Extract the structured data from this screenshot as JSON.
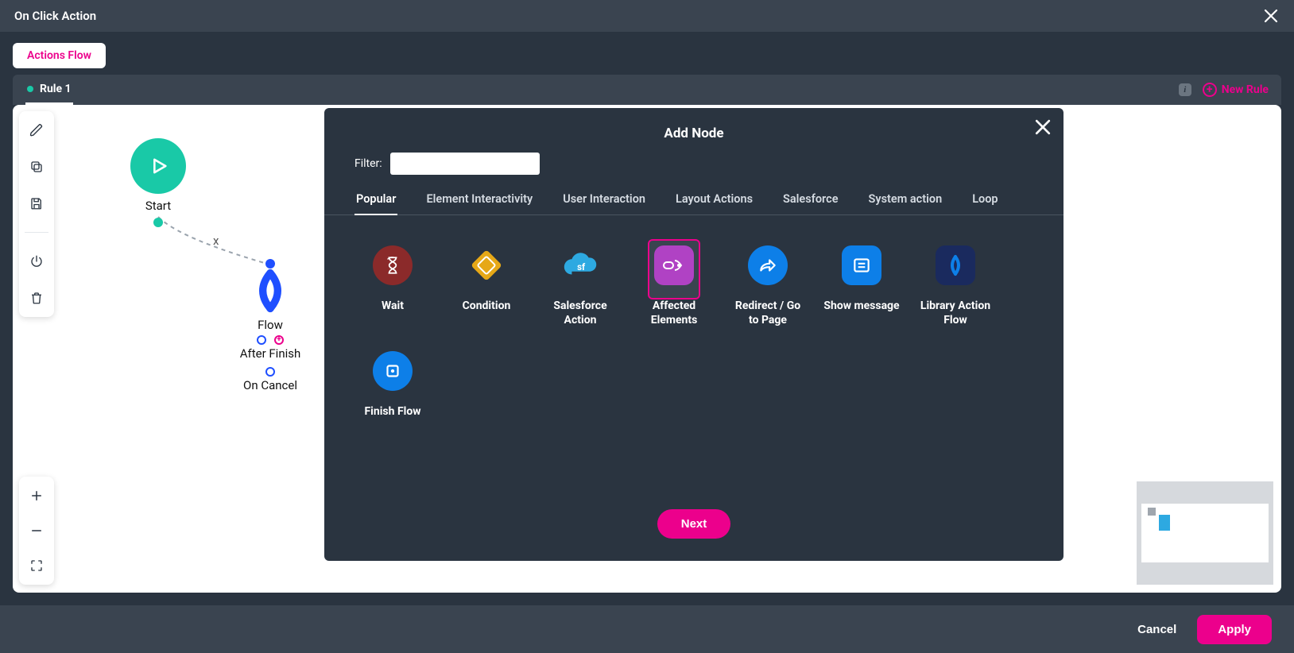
{
  "title": "On Click Action",
  "flow_tab_label": "Actions Flow",
  "rule_tab_label": "Rule 1",
  "new_rule_label": "New Rule",
  "canvas": {
    "start_label": "Start",
    "flow_label": "Flow",
    "after_finish_label": "After Finish",
    "on_cancel_label": "On Cancel",
    "edge_marker": "x"
  },
  "panel": {
    "title": "Add Node",
    "filter_label": "Filter:",
    "filter_value": "",
    "categories": [
      "Popular",
      "Element Interactivity",
      "User Interaction",
      "Layout Actions",
      "Salesforce",
      "System action",
      "Loop"
    ],
    "active_category": 0,
    "nodes": [
      {
        "name": "Wait",
        "color": "#8b2a2a",
        "selected": false
      },
      {
        "name": "Condition",
        "color": "#e6a817",
        "selected": false
      },
      {
        "name": "Salesforce Action",
        "color": "#2da9e1",
        "selected": false
      },
      {
        "name": "Affected Elements",
        "color": "#b042c4",
        "selected": true
      },
      {
        "name": "Redirect / Go to Page",
        "color": "#0d7fe8",
        "selected": false
      },
      {
        "name": "Show message",
        "color": "#0d7fe8",
        "selected": false
      },
      {
        "name": "Library Action Flow",
        "color": "#1a2a5e",
        "selected": false
      },
      {
        "name": "Finish Flow",
        "color": "#0d7fe8",
        "selected": false
      }
    ],
    "next_label": "Next"
  },
  "footer": {
    "cancel_label": "Cancel",
    "apply_label": "Apply"
  }
}
